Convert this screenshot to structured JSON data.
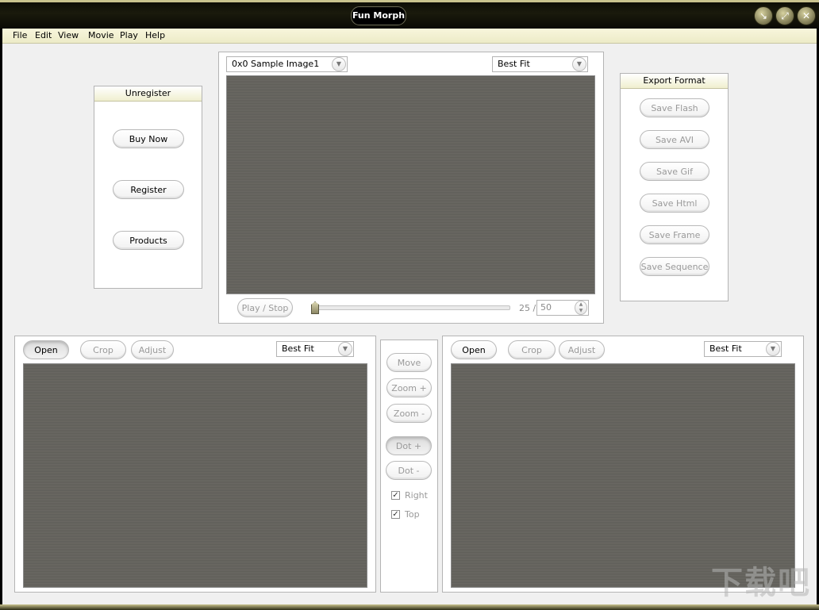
{
  "window": {
    "title": "Fun Morph"
  },
  "menu": [
    "File",
    "Edit",
    "View",
    "Movie",
    "Play",
    "Help"
  ],
  "unregister_panel": {
    "title": "Unregister",
    "buttons": [
      "Buy Now",
      "Register",
      "Products"
    ]
  },
  "preview": {
    "source_select": "0x0 Sample Image1",
    "fit_select": "Best Fit",
    "play_stop": "Play / Stop",
    "frame_current": "25 /",
    "frame_total": "50",
    "slider_fraction": 0.0
  },
  "export_panel": {
    "title": "Export Format",
    "buttons": [
      "Save Flash",
      "Save AVI",
      "Save Gif",
      "Save Html",
      "Save Frame",
      "Save Sequence"
    ]
  },
  "left_image": {
    "open": "Open",
    "crop": "Crop",
    "adjust": "Adjust",
    "fit_select": "Best Fit"
  },
  "right_image": {
    "open": "Open",
    "crop": "Crop",
    "adjust": "Adjust",
    "fit_select": "Best Fit"
  },
  "tools": {
    "move": "Move",
    "zoom_in": "Zoom +",
    "zoom_out": "Zoom -",
    "dot_add": "Dot +",
    "dot_remove": "Dot -",
    "right_label": "Right",
    "right_checked": true,
    "top_label": "Top",
    "top_checked": true
  },
  "colors": {
    "frame": "#0d0d06",
    "accent": "#c9c38e",
    "menubar": "#f4f2d2",
    "canvas": "#656460"
  }
}
